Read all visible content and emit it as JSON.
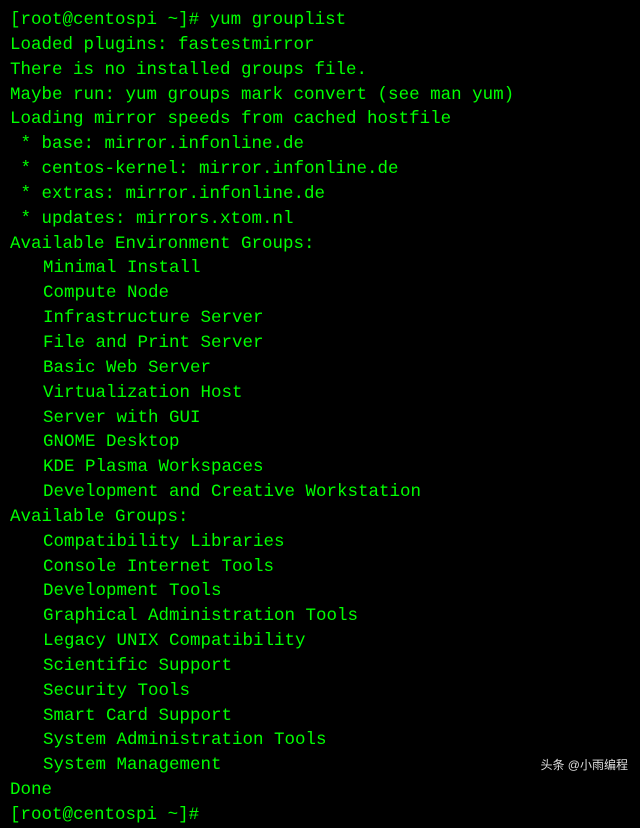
{
  "prompt": {
    "open": "[",
    "user": "root",
    "at": "@",
    "host": "centospi",
    "dir": " ~",
    "close": "]#",
    "command": "yum grouplist"
  },
  "headerLines": [
    "Loaded plugins: fastestmirror",
    "There is no installed groups file.",
    "Maybe run: yum groups mark convert (see man yum)",
    "Loading mirror speeds from cached hostfile"
  ],
  "mirrors": [
    " * base: mirror.infonline.de",
    " * centos-kernel: mirror.infonline.de",
    " * extras: mirror.infonline.de",
    " * updates: mirrors.xtom.nl"
  ],
  "envGroupsHeader": "Available Environment Groups:",
  "envGroups": [
    "Minimal Install",
    "Compute Node",
    "Infrastructure Server",
    "File and Print Server",
    "Basic Web Server",
    "Virtualization Host",
    "Server with GUI",
    "GNOME Desktop",
    "KDE Plasma Workspaces",
    "Development and Creative Workstation"
  ],
  "availGroupsHeader": "Available Groups:",
  "availGroups": [
    "Compatibility Libraries",
    "Console Internet Tools",
    "Development Tools",
    "Graphical Administration Tools",
    "Legacy UNIX Compatibility",
    "Scientific Support",
    "Security Tools",
    "Smart Card Support",
    "System Administration Tools",
    "System Management"
  ],
  "doneLine": "Done",
  "prompt2": {
    "open": "[",
    "user": "root",
    "at": "@",
    "host": "centospi",
    "dir": " ~",
    "close": "]#"
  },
  "watermark": "头条 @小雨编程"
}
